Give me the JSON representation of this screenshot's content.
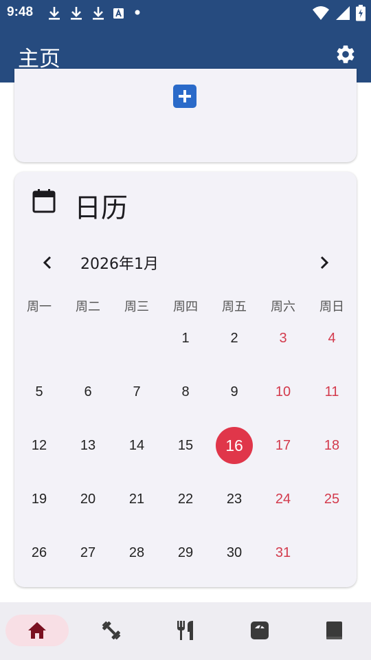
{
  "status_bar": {
    "time": "9:48",
    "left_icons": [
      "download-icon",
      "download-icon",
      "download-icon",
      "text-notification-icon",
      "dot-icon"
    ],
    "right_icons": [
      "wifi-icon",
      "signal-icon",
      "battery-charging-icon"
    ]
  },
  "app_bar": {
    "title": "主页",
    "settings_icon": "gear-icon"
  },
  "colors": {
    "primary": "#264b7f",
    "accent_blue": "#2a6ac9",
    "today": "#e0364a",
    "weekend": "#d33a4c",
    "nav_active": "#7a1020"
  },
  "top_card": {
    "action_icon": "add-icon"
  },
  "calendar": {
    "title": "日历",
    "icon": "calendar-icon",
    "month_label": "2026年1月",
    "weekdays": [
      "周一",
      "周二",
      "周三",
      "周四",
      "周五",
      "周六",
      "周日"
    ],
    "first_weekday_index": 3,
    "days_in_month": 31,
    "today": 16,
    "weekend_columns": [
      5,
      6
    ],
    "days": [
      "1",
      "2",
      "3",
      "4",
      "5",
      "6",
      "7",
      "8",
      "9",
      "10",
      "11",
      "12",
      "13",
      "14",
      "15",
      "16",
      "17",
      "18",
      "19",
      "20",
      "21",
      "22",
      "23",
      "24",
      "25",
      "26",
      "27",
      "28",
      "29",
      "30",
      "31"
    ]
  },
  "bottom_nav": {
    "items": [
      {
        "icon": "home-icon",
        "active": true
      },
      {
        "icon": "dumbbell-icon",
        "active": false
      },
      {
        "icon": "fork-knife-icon",
        "active": false
      },
      {
        "icon": "scale-icon",
        "active": false
      },
      {
        "icon": "notebook-icon",
        "active": false
      }
    ]
  }
}
